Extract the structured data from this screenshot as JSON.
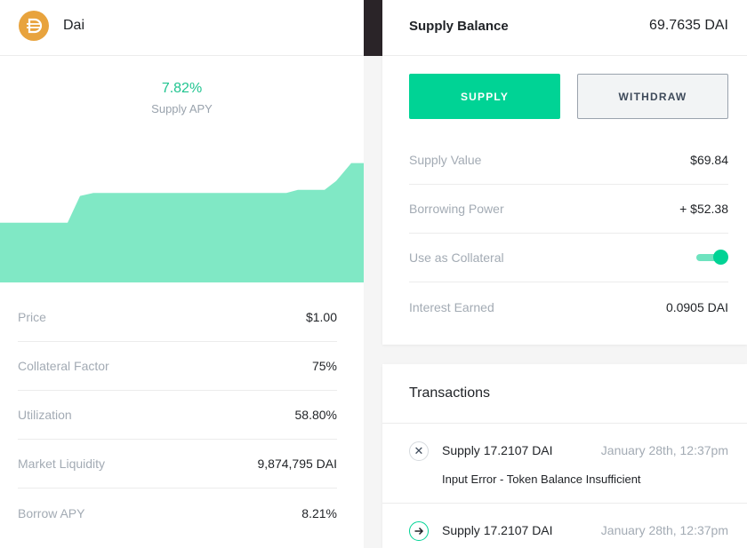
{
  "colors": {
    "accent": "#00d395",
    "apy_text": "#1fc48f",
    "chart_fill": "#80e8c5",
    "token_icon": "#e8a33d",
    "muted_text": "#a3abb4"
  },
  "token": {
    "icon": "dai-icon",
    "name": "Dai"
  },
  "apy": {
    "value": "7.82%",
    "label": "Supply APY"
  },
  "apy_history": [
    0.45,
    0.45,
    0.45,
    0.45,
    0.62,
    0.64,
    0.64,
    0.64,
    0.64,
    0.64,
    0.64,
    0.64,
    0.64,
    0.65,
    0.65,
    0.8
  ],
  "market_stats": [
    {
      "label": "Price",
      "value": "$1.00"
    },
    {
      "label": "Collateral Factor",
      "value": "75%"
    },
    {
      "label": "Utilization",
      "value": "58.80%"
    },
    {
      "label": "Market Liquidity",
      "value": "9,874,795 DAI"
    },
    {
      "label": "Borrow APY",
      "value": "8.21%"
    }
  ],
  "supply_card": {
    "title": "Supply Balance",
    "balance": "69.7635 DAI",
    "supply_button": "SUPPLY",
    "withdraw_button": "WITHDRAW",
    "rows": [
      {
        "label": "Supply Value",
        "value": "$69.84"
      },
      {
        "label": "Borrowing Power",
        "value": "+ $52.38"
      },
      {
        "label": "Use as Collateral",
        "toggle_on": true
      },
      {
        "label": "Interest Earned",
        "value": "0.0905 DAI"
      }
    ]
  },
  "transactions": {
    "title": "Transactions",
    "items": [
      {
        "status_icon": "close-icon",
        "description": "Supply 17.2107 DAI",
        "date": "January 28th, 12:37pm",
        "error": "Input Error - Token Balance Insufficient"
      },
      {
        "status_icon": "arrow-right-icon",
        "description": "Supply 17.2107 DAI",
        "date": "January 28th, 12:37pm"
      }
    ]
  }
}
